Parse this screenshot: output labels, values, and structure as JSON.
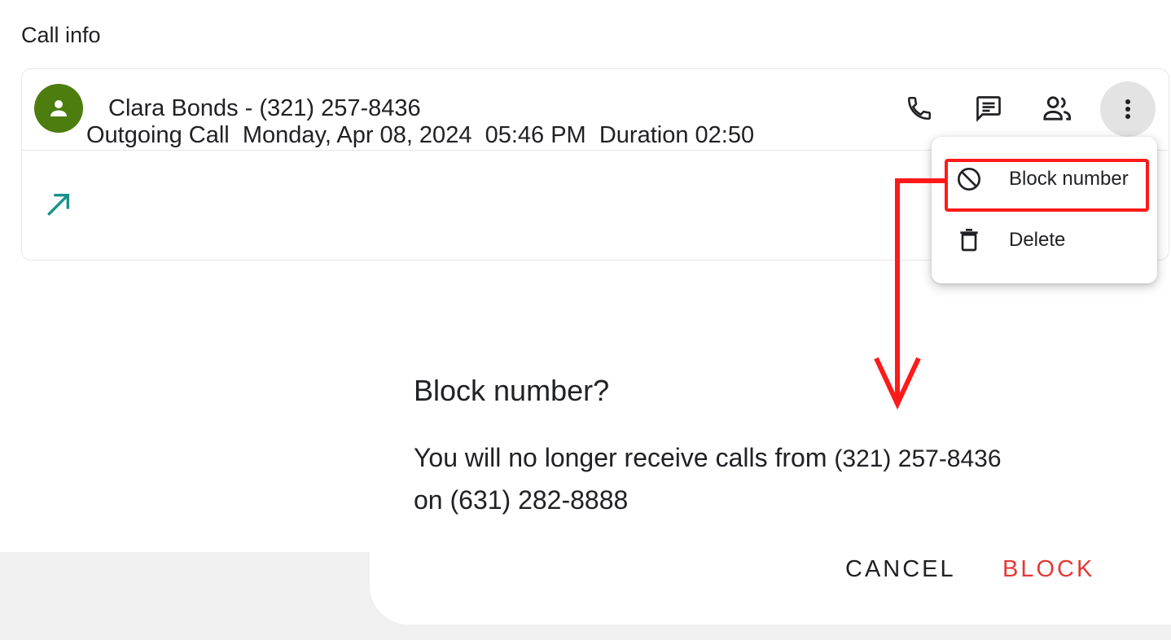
{
  "page": {
    "title": "Call info"
  },
  "contact": {
    "display": "Clara Bonds - (321) 257-8436",
    "avatar_color": "#4d7c0f",
    "avatar_icon": "person-icon"
  },
  "actions": [
    {
      "icon": "phone-icon"
    },
    {
      "icon": "message-icon"
    },
    {
      "icon": "contacts-icon"
    },
    {
      "icon": "more-vert-icon"
    }
  ],
  "call_detail": {
    "type": "Outgoing Call",
    "date": "Monday, Apr 08, 2024",
    "time": "05:46 PM",
    "duration": "Duration 02:50",
    "icon": "outgoing-call-icon",
    "icon_color": "#16938a"
  },
  "menu": {
    "items": [
      {
        "label": "Block number",
        "icon": "block-icon"
      },
      {
        "label": "Delete",
        "icon": "trash-icon"
      }
    ]
  },
  "annotation": {
    "color": "#ff1a1a"
  },
  "dialog": {
    "title": "Block number?",
    "body_prefix": "You will no longer receive calls from",
    "blocked_number": "(321) 257-8436",
    "body_on": "on",
    "own_number": "(631) 282-8888",
    "cancel_label": "CANCEL",
    "block_label": "BLOCK",
    "block_color": "#e53935"
  }
}
